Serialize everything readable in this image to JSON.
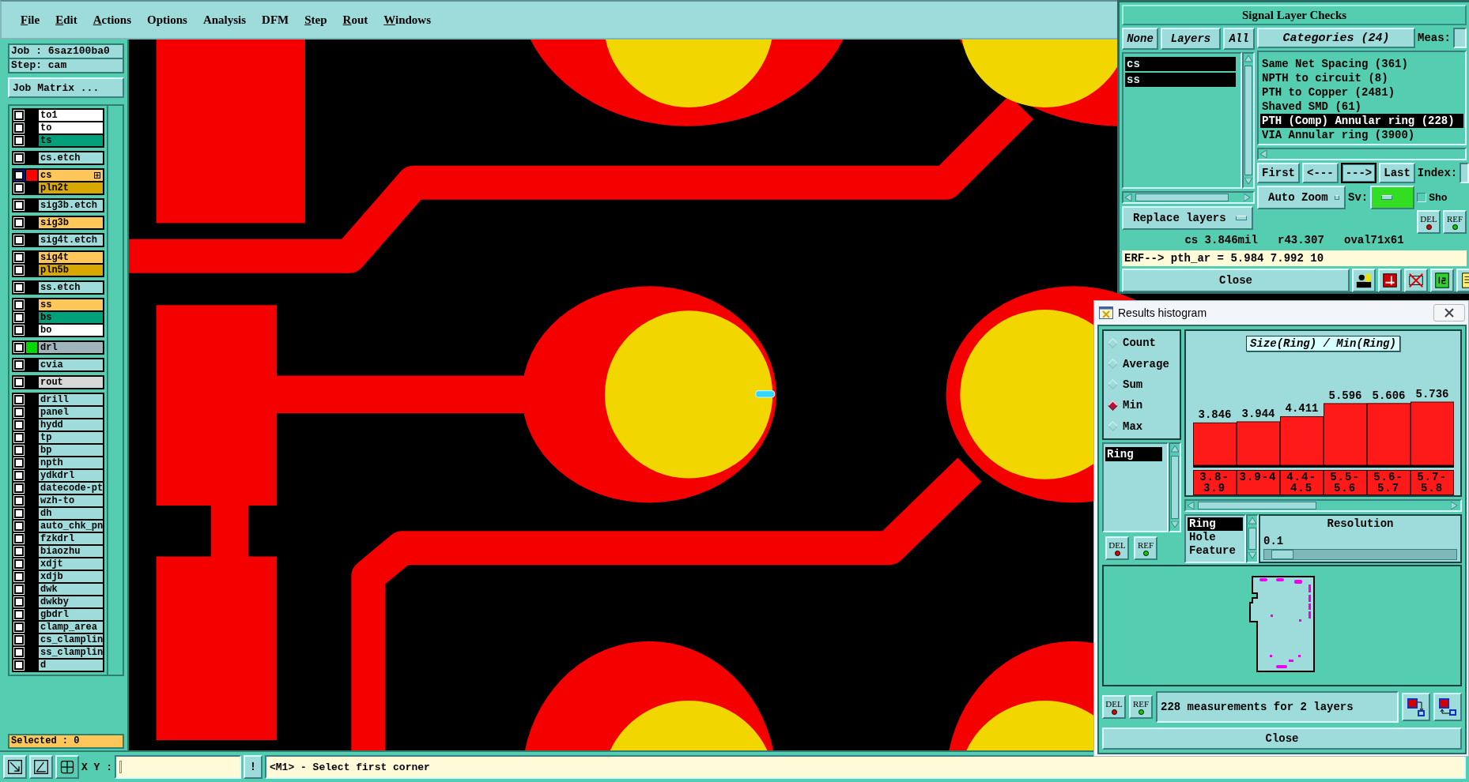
{
  "menu": [
    {
      "label": "File",
      "mnemonic": true
    },
    {
      "label": "Edit",
      "mnemonic": true
    },
    {
      "label": "Actions",
      "mnemonic": true
    },
    {
      "label": "Options",
      "mnemonic": false
    },
    {
      "label": "Analysis",
      "mnemonic": false
    },
    {
      "label": "DFM",
      "mnemonic": false
    },
    {
      "label": "Step",
      "mnemonic": true
    },
    {
      "label": "Rout",
      "mnemonic": true
    },
    {
      "label": "Windows",
      "mnemonic": true
    }
  ],
  "job": {
    "job_label": "Job : 6saz100ba0",
    "step_label": "Step: cam",
    "matrix_button": "Job Matrix ..."
  },
  "layer_groups": [
    {
      "layers": [
        {
          "name": "to1",
          "kind": "silk",
          "selected": false,
          "checked": false
        },
        {
          "name": "to",
          "kind": "silk",
          "selected": false,
          "checked": false
        },
        {
          "name": "ts",
          "kind": "mask",
          "selected": false,
          "checked": false
        }
      ]
    },
    {
      "layers": [
        {
          "name": "cs.etch",
          "kind": "document",
          "selected": false,
          "checked": false
        }
      ]
    },
    {
      "layers": [
        {
          "name": "cs",
          "kind": "signal",
          "selected": true,
          "checked": false,
          "color": "#ff0000"
        },
        {
          "name": "pln2t",
          "kind": "plane",
          "selected": false,
          "checked": false
        }
      ]
    },
    {
      "layers": [
        {
          "name": "sig3b.etch",
          "kind": "document",
          "selected": false,
          "checked": false
        }
      ]
    },
    {
      "layers": [
        {
          "name": "sig3b",
          "kind": "signal",
          "selected": false,
          "checked": false
        }
      ]
    },
    {
      "layers": [
        {
          "name": "sig4t.etch",
          "kind": "document",
          "selected": false,
          "checked": false
        }
      ]
    },
    {
      "layers": [
        {
          "name": "sig4t",
          "kind": "signal",
          "selected": false,
          "checked": false
        },
        {
          "name": "pln5b",
          "kind": "plane",
          "selected": false,
          "checked": false
        }
      ]
    },
    {
      "layers": [
        {
          "name": "ss.etch",
          "kind": "document",
          "selected": false,
          "checked": false
        }
      ]
    },
    {
      "layers": [
        {
          "name": "ss",
          "kind": "signal",
          "selected": false,
          "checked": false
        },
        {
          "name": "bs",
          "kind": "mask",
          "selected": false,
          "checked": false
        },
        {
          "name": "bo",
          "kind": "silk",
          "selected": false,
          "checked": false
        }
      ]
    },
    {
      "layers": [
        {
          "name": "drl",
          "kind": "drill",
          "selected": false,
          "checked": false,
          "color": "#00d800"
        }
      ]
    },
    {
      "layers": [
        {
          "name": "cvia",
          "kind": "document",
          "selected": false,
          "checked": false
        }
      ]
    },
    {
      "layers": [
        {
          "name": "rout",
          "kind": "rout",
          "selected": false,
          "checked": false
        }
      ]
    },
    {
      "layers": [
        {
          "name": "drill",
          "kind": "document",
          "selected": false,
          "checked": false
        },
        {
          "name": "panel",
          "kind": "document",
          "selected": false,
          "checked": false
        },
        {
          "name": "hydd",
          "kind": "document",
          "selected": false,
          "checked": false
        },
        {
          "name": "tp",
          "kind": "document",
          "selected": false,
          "checked": false
        },
        {
          "name": "bp",
          "kind": "document",
          "selected": false,
          "checked": false
        },
        {
          "name": "npth",
          "kind": "document",
          "selected": false,
          "checked": false
        },
        {
          "name": "ydkdrl",
          "kind": "document",
          "selected": false,
          "checked": false
        },
        {
          "name": "datecode-pt",
          "kind": "document",
          "selected": false,
          "checked": false
        },
        {
          "name": "wzh-to",
          "kind": "document",
          "selected": false,
          "checked": false
        },
        {
          "name": "dh",
          "kind": "document",
          "selected": false,
          "checked": false
        },
        {
          "name": "auto_chk_pn",
          "kind": "document",
          "selected": false,
          "checked": false
        },
        {
          "name": "fzkdrl",
          "kind": "document",
          "selected": false,
          "checked": false
        },
        {
          "name": "biaozhu",
          "kind": "document",
          "selected": false,
          "checked": false
        },
        {
          "name": "xdjt",
          "kind": "document",
          "selected": false,
          "checked": false
        },
        {
          "name": "xdjb",
          "kind": "document",
          "selected": false,
          "checked": false
        },
        {
          "name": "dwk",
          "kind": "document",
          "selected": false,
          "checked": false
        },
        {
          "name": "dwkby",
          "kind": "document",
          "selected": false,
          "checked": false
        },
        {
          "name": "gbdrl",
          "kind": "document",
          "selected": false,
          "checked": false
        },
        {
          "name": "clamp_area",
          "kind": "document",
          "selected": false,
          "checked": false
        },
        {
          "name": "cs_clamplin",
          "kind": "document",
          "selected": false,
          "checked": false
        },
        {
          "name": "ss_clamplin",
          "kind": "document",
          "selected": false,
          "checked": false
        },
        {
          "name": "d",
          "kind": "document",
          "selected": false,
          "checked": false
        }
      ]
    }
  ],
  "selected_count": "Selected : 0",
  "bottom_bar": {
    "xy_label": "X Y :",
    "bang_button": "!",
    "message": "<M1> - Select first corner"
  },
  "signal_checks": {
    "title": "Signal Layer Checks",
    "layer_buttons": [
      "None",
      "Layers",
      "All"
    ],
    "layers": [
      {
        "name": "cs",
        "selected": true
      },
      {
        "name": "ss",
        "selected": true
      }
    ],
    "replace_mode": "Replace layers",
    "categories_button": "Categories (24)",
    "meas_label": "Meas:",
    "categories": [
      {
        "label": "Same Net Spacing (361)",
        "selected": false
      },
      {
        "label": "NPTH to circuit (8)",
        "selected": false
      },
      {
        "label": "PTH to Copper (2481)",
        "selected": false
      },
      {
        "label": "Shaved SMD (61)",
        "selected": false
      },
      {
        "label": "PTH (Comp) Annular ring (228)",
        "selected": true
      },
      {
        "label": "VIA Annular ring (3900)",
        "selected": false
      }
    ],
    "nav_buttons": [
      {
        "label": "First",
        "pressed": false
      },
      {
        "label": "<---",
        "pressed": false
      },
      {
        "label": "--->",
        "pressed": true
      },
      {
        "label": "Last",
        "pressed": false
      }
    ],
    "index_label": "Index:",
    "zoom_mode": "Auto Zoom",
    "sv_label": "Sv:",
    "show_checkbox": {
      "label": "Sho",
      "checked": false
    },
    "del": "DEL",
    "ref": "REF",
    "status": "cs 3.846mil   r43.307   oval71x61",
    "erf": "ERF--> pth_ar = 5.984 7.992 10",
    "close": "Close"
  },
  "histogram": {
    "title": "Results histogram",
    "modes": [
      {
        "label": "Count",
        "selected": false
      },
      {
        "label": "Average",
        "selected": false
      },
      {
        "label": "Sum",
        "selected": false
      },
      {
        "label": "Min",
        "selected": true
      },
      {
        "label": "Max",
        "selected": false
      }
    ],
    "fields": [
      {
        "name": "Ring",
        "selected": true
      }
    ],
    "list_del": "DEL",
    "list_ref": "REF",
    "chart_data": {
      "type": "bar",
      "title": "Size(Ring) / Min(Ring)",
      "categories": [
        "3.8-3.9",
        "3.9-4",
        "4.4-4.5",
        "5.5-5.6",
        "5.6-5.7",
        "5.7-5.8"
      ],
      "values": [
        3.846,
        3.944,
        4.411,
        5.596,
        5.606,
        5.736
      ],
      "data_labels": true
    },
    "group_by": [
      {
        "label": "Ring",
        "selected": true
      },
      {
        "label": "Hole",
        "selected": false
      },
      {
        "label": "Feature",
        "selected": false
      }
    ],
    "resolution": {
      "label": "Resolution",
      "value": "0.1",
      "level": 0.04
    },
    "summary_del": "DEL",
    "summary_ref": "REF",
    "summary": "228 measurements for 2 layers",
    "close": "Close"
  }
}
